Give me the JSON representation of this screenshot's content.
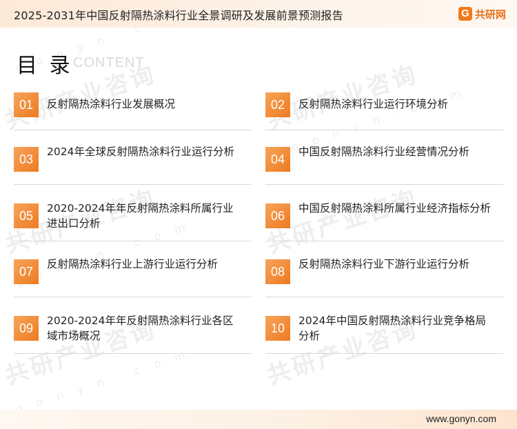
{
  "header": {
    "title": "2025-2031年中国反射隔热涂料行业全景调研及发展前景预测报告",
    "brand_mark": "G",
    "brand_name": "共研网"
  },
  "watermark": {
    "cn": "共研产业咨询",
    "en": "g o n y n . c o m"
  },
  "toc": {
    "title": "目 录",
    "subtitle": "CONTENT"
  },
  "items": [
    {
      "num": "01",
      "label": "反射隔热涂料行业发展概况"
    },
    {
      "num": "02",
      "label": "反射隔热涂料行业运行环境分析"
    },
    {
      "num": "03",
      "label": "2024年全球反射隔热涂料行业运行分析"
    },
    {
      "num": "04",
      "label": "中国反射隔热涂料行业经营情况分析"
    },
    {
      "num": "05",
      "label": "2020-2024年年反射隔热涂料所属行业进出口分析"
    },
    {
      "num": "06",
      "label": "中国反射隔热涂料所属行业经济指标分析"
    },
    {
      "num": "07",
      "label": "反射隔热涂料行业上游行业运行分析"
    },
    {
      "num": "08",
      "label": "反射隔热涂料行业下游行业运行分析"
    },
    {
      "num": "09",
      "label": "2020-2024年年反射隔热涂料行业各区域市场概况"
    },
    {
      "num": "10",
      "label": "2024年中国反射隔热涂料行业竞争格局分析"
    }
  ],
  "footer": {
    "url": "www.gonyn.com"
  },
  "colors": {
    "accent": "#ee7a20",
    "header_bg": "#fde9d8"
  }
}
